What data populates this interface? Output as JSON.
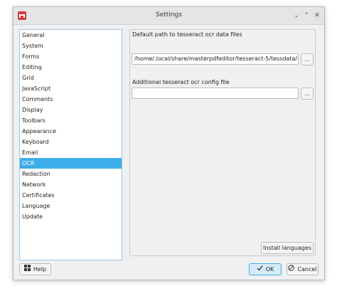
{
  "window": {
    "title": "Settings"
  },
  "titlebar": {
    "collapse_glyph": "⌄",
    "expand_glyph": "⌃",
    "close_glyph": "✕"
  },
  "sidebar": {
    "items": [
      {
        "label": "General"
      },
      {
        "label": "System"
      },
      {
        "label": "Forms"
      },
      {
        "label": "Editing"
      },
      {
        "label": "Grid"
      },
      {
        "label": "JavaScript"
      },
      {
        "label": "Comments"
      },
      {
        "label": "Display"
      },
      {
        "label": "Toolbars"
      },
      {
        "label": "Appearance"
      },
      {
        "label": "Keyboard"
      },
      {
        "label": "Email"
      },
      {
        "label": "OCR",
        "selected": true
      },
      {
        "label": "Redaction"
      },
      {
        "label": "Network"
      },
      {
        "label": "Certificates"
      },
      {
        "label": "Language"
      },
      {
        "label": "Update"
      }
    ]
  },
  "ocr": {
    "data_path_label": "Default path to tesseract ocr data files",
    "data_path_value": "/home/.local/share/masterpdfeditor/tesseract-5/tessdata/",
    "browse_label": "...",
    "config_label": "Additional tesseract ocr config file",
    "config_value": "",
    "install_label": "Install languages"
  },
  "footer": {
    "help_label": "Help",
    "ok_label": "OK",
    "cancel_label": "Cancel"
  },
  "icons": {
    "help": "help-icon",
    "ok": "checkmark-icon",
    "cancel": "cancel-icon"
  },
  "colors": {
    "accent": "#3daee9"
  }
}
